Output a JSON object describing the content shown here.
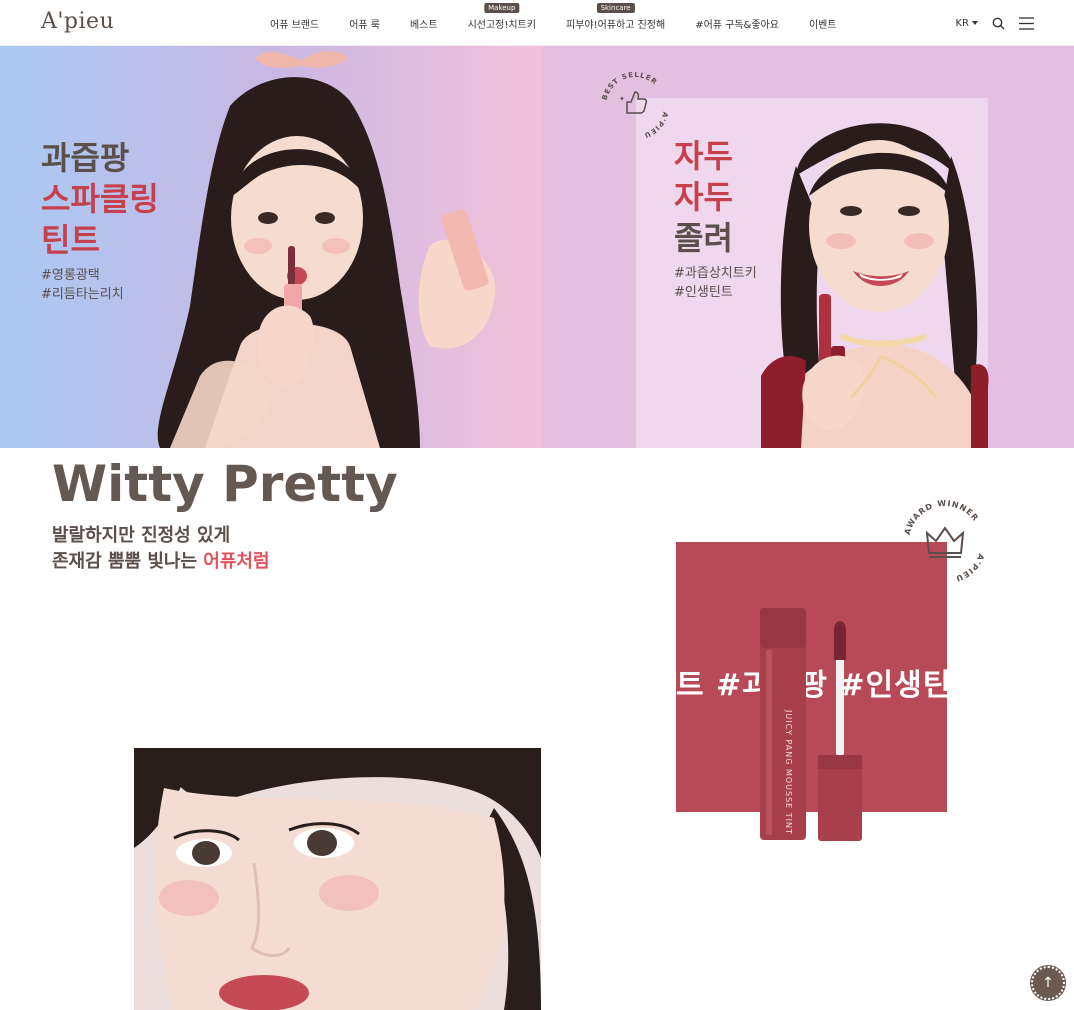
{
  "header": {
    "logo": "A'pieu",
    "nav": [
      {
        "label": "어퓨 브랜드",
        "tag": ""
      },
      {
        "label": "어퓨 룩",
        "tag": ""
      },
      {
        "label": "베스트",
        "tag": ""
      },
      {
        "label": "시선고정!치트키",
        "tag": "Makeup"
      },
      {
        "label": "피부야!어퓨하고 진정해",
        "tag": "Skincare"
      },
      {
        "label": "#어퓨 구독&좋아요",
        "tag": ""
      },
      {
        "label": "이벤트",
        "tag": ""
      }
    ],
    "lang": "KR"
  },
  "hero_left": {
    "line1": "과즙팡",
    "line2": "스파클링",
    "line3": "틴트",
    "hash1": "#영롱광택",
    "hash2": "#리듬타는리치"
  },
  "hero_right": {
    "badge_top": "BEST SELLER",
    "badge_side": "A'PIEU",
    "line1": "자두",
    "line2": "자두",
    "line3": "졸려",
    "hash1": "#과즙상치트키",
    "hash2": "#인생틴트"
  },
  "section": {
    "title": "Witty Pretty",
    "tagline1": "발랄하지만 진정성 있게",
    "tagline2_pre": "존재감 뿜뿜 빛나는 ",
    "tagline2_accent": "어퓨처럼"
  },
  "product": {
    "bg_text": "트 #과즙팡 #인생틴트",
    "tube_label": "JUICY PANG MOUSSE TINT",
    "award_top": "AWARD WINNER",
    "award_side": "A'PIEU"
  },
  "colors": {
    "accent": "#c7404d",
    "text": "#5a4f4a",
    "product_bg": "#b84a57"
  },
  "totop_icon": "arrow-up-icon"
}
